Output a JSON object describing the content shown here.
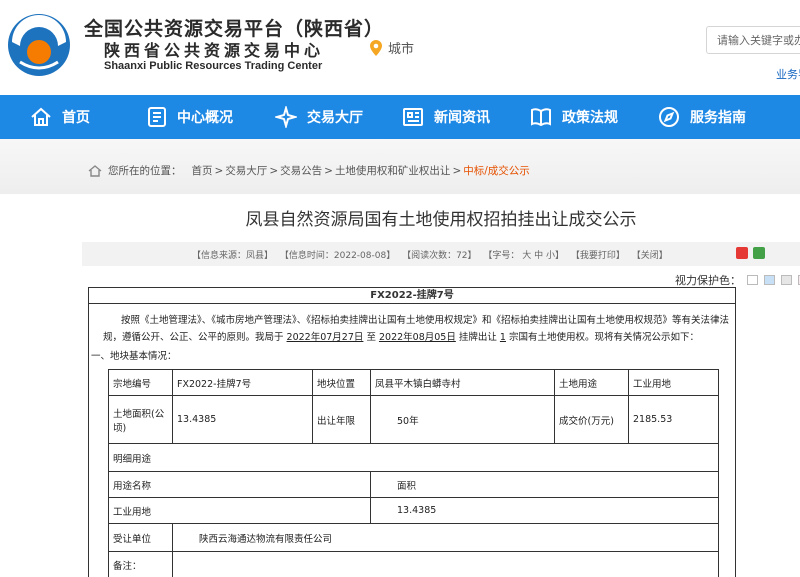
{
  "header": {
    "title_cn_line1": "全国公共资源交易平台（陕西省）",
    "title_cn_line2": "陕西省公共资源交易中心",
    "title_en": "Shaanxi Public Resources Trading Center",
    "city_label": "城市",
    "search_placeholder": "请输入关键字或办",
    "biz_link": "业务导"
  },
  "nav": {
    "items": [
      {
        "label": "首页",
        "icon": "home-icon"
      },
      {
        "label": "中心概况",
        "icon": "document-icon"
      },
      {
        "label": "交易大厅",
        "icon": "sparkle-icon"
      },
      {
        "label": "新闻资讯",
        "icon": "newspaper-icon"
      },
      {
        "label": "政策法规",
        "icon": "book-icon"
      },
      {
        "label": "服务指南",
        "icon": "compass-icon"
      }
    ]
  },
  "breadcrumb": {
    "prefix": "您所在的位置：",
    "items": [
      "首页",
      "交易大厅",
      "交易公告",
      "土地使用权和矿业权出让",
      "中标/成交公示"
    ],
    "separator": ">"
  },
  "article": {
    "title": "凤县自然资源局国有土地使用权招拍挂出让成交公示",
    "meta": {
      "source": "【信息来源：凤县】",
      "time": "【信息时间：2022-08-08】",
      "views": "【阅读次数：72】",
      "font_size": "【字号： 大  中  小】",
      "print": "【我要打印】",
      "close": "【关闭】"
    },
    "vision_label": "视力保护色：",
    "vision_colors": [
      "#ffffff",
      "#c7e0f5",
      "#e6e6e6",
      "#f7e7ee"
    ]
  },
  "notice": {
    "header": "FX2022-挂牌7号",
    "para_part1": "按照《土地管理法》、《城市房地产管理法》、《招标拍卖挂牌出让国有土地使用权规定》和《招标拍卖挂牌出让国有土地使用权规范》等有关法律法规，遵循公开、公正、公平的原则。我局于",
    "date_start": "2022年07月27日",
    "para_to": "至",
    "date_end": "2022年08月05日",
    "para_part2": "挂牌出让",
    "parcel_count": "1",
    "para_part3": "宗国有土地使用权。现将有关情况公示如下：",
    "section_title": "一、地块基本情况："
  },
  "land_table": {
    "row1": {
      "k1": "宗地编号",
      "v1": "FX2022-挂牌7号",
      "k2": "地块位置",
      "v2": "凤县平木镇白蟒寺村",
      "k3": "土地用途",
      "v3": "工业用地"
    },
    "row2": {
      "k1": "土地面积(公顷)",
      "v1": "13.4385",
      "k2": "出让年限",
      "v2": "50年",
      "k3": "成交价(万元)",
      "v3": "2185.53"
    },
    "row3": {
      "k1": "明细用途"
    },
    "row4": {
      "k1": "用途名称",
      "k2": "面积"
    },
    "row5": {
      "k1": "工业用地",
      "v2": "13.4385"
    },
    "row6": {
      "k1": "受让单位",
      "v1": "陕西云海通达物流有限责任公司"
    },
    "row7": {
      "k1": "备注："
    }
  },
  "colors": {
    "nav_blue": "#1e88e5",
    "breadcrumb_current": "#e65100",
    "logo_orange": "#f57c00",
    "logo_blue": "#1e73be"
  }
}
